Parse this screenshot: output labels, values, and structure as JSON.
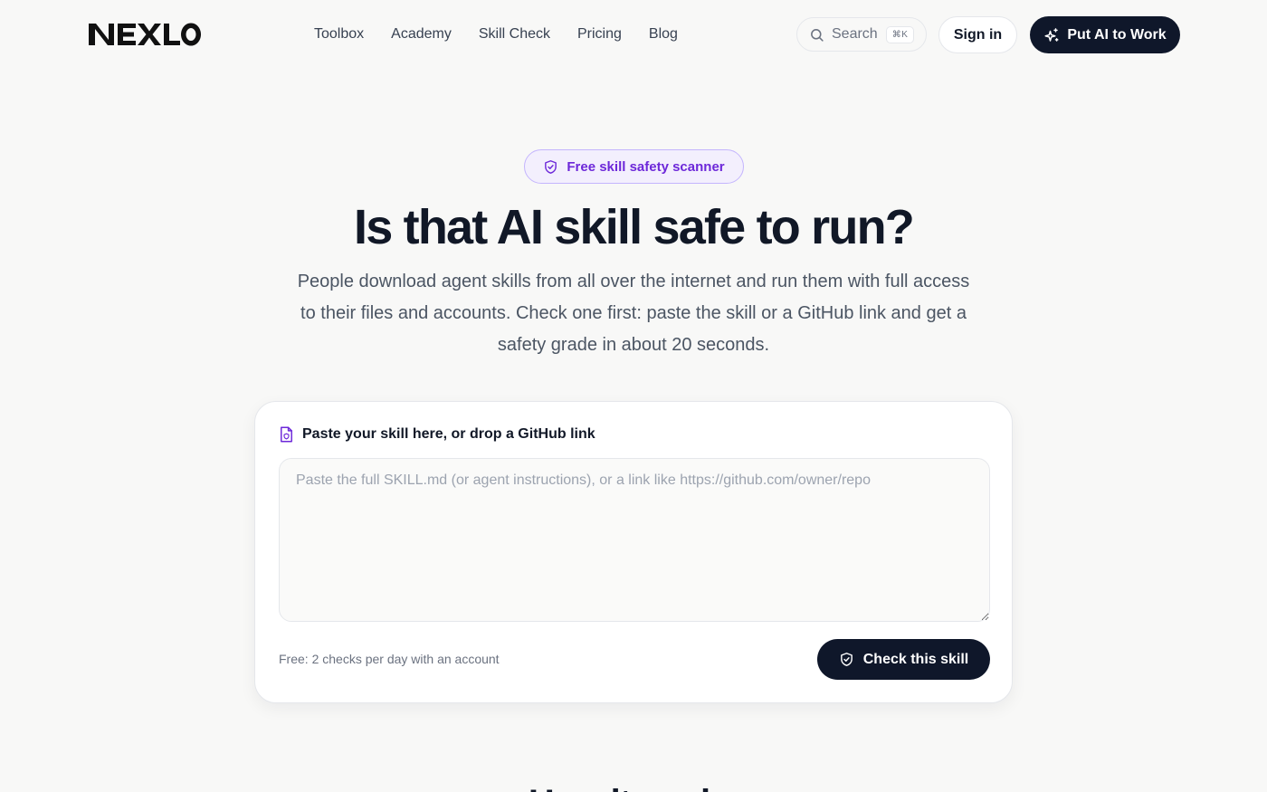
{
  "brand": {
    "logo_text": "NEXLO"
  },
  "nav": {
    "items": [
      {
        "label": "Toolbox"
      },
      {
        "label": "Academy"
      },
      {
        "label": "Skill Check"
      },
      {
        "label": "Pricing"
      },
      {
        "label": "Blog"
      }
    ]
  },
  "header": {
    "search_label": "Search",
    "search_shortcut": "⌘K",
    "signin_label": "Sign in",
    "cta_label": "Put AI to Work",
    "cta_icon": "sparkles-icon"
  },
  "hero": {
    "badge_label": "Free skill safety scanner",
    "badge_icon": "shield-check-icon",
    "title": "Is that AI skill safe to run?",
    "description": "People download agent skills from all over the internet and run them with full access to their files and accounts. Check one first: paste the skill or a GitHub link and get a safety grade in about 20 seconds."
  },
  "scanner": {
    "label": "Paste your skill here, or drop a GitHub link",
    "label_icon": "file-icon",
    "input_value": "",
    "input_placeholder": "Paste the full SKILL.md (or agent instructions), or a link like https://github.com/owner/repo",
    "free_note": "Free: 2 checks per day with an account",
    "submit_label": "Check this skill",
    "submit_icon": "shield-check-icon"
  },
  "next_section": {
    "heading": "How it works"
  },
  "colors": {
    "background": "#f8f8f7",
    "primary_dark": "#0f172a",
    "accent_purple": "#6d28d9",
    "badge_bg": "#f3effd"
  }
}
